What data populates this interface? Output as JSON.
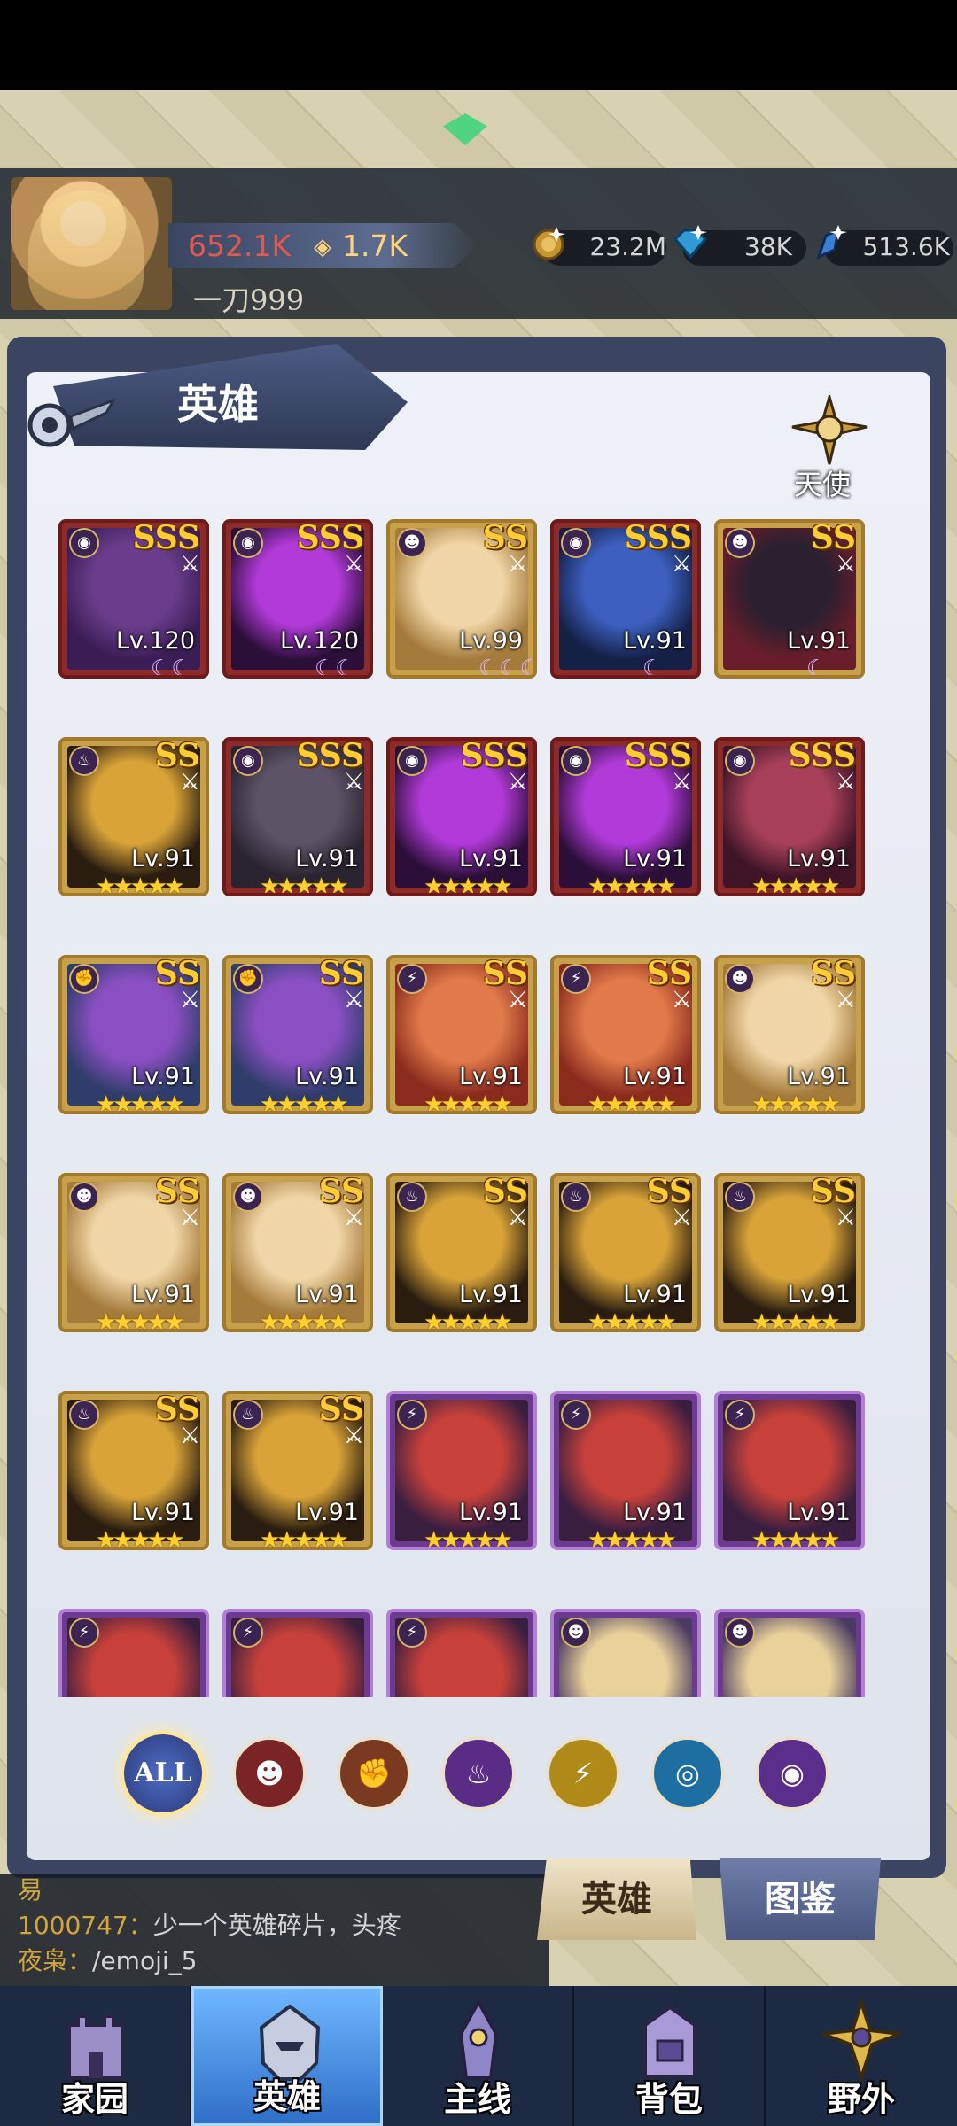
{
  "header": {
    "power": "652.1K",
    "secondary_stat": "1.7K",
    "player_name": "一刀999",
    "resources": [
      {
        "icon": "gold-coin-icon",
        "value": "23.2M"
      },
      {
        "icon": "diamond-icon",
        "value": "38K"
      },
      {
        "icon": "crystal-shard-icon",
        "value": "513.6K"
      }
    ]
  },
  "panel": {
    "title": "英雄",
    "angel_label": "天使"
  },
  "heroes": [
    {
      "rank": "SSS",
      "level": "Lv.120",
      "stars": "",
      "moons": "☾☾",
      "frame": "red",
      "element": "arcane",
      "art": "purple-crab"
    },
    {
      "rank": "SSS",
      "level": "Lv.120",
      "stars": "",
      "moons": "☾☾",
      "frame": "red",
      "element": "arcane",
      "art": "purple-demon"
    },
    {
      "rank": "SS",
      "level": "Lv.99",
      "stars": "",
      "moons": "☾☾☾☾",
      "frame": "gold",
      "element": "demon",
      "art": "blonde-warrior"
    },
    {
      "rank": "SSS",
      "level": "Lv.91",
      "stars": "",
      "moons": "☾",
      "frame": "red",
      "element": "arcane",
      "art": "blue-ghoul"
    },
    {
      "rank": "SS",
      "level": "Lv.91",
      "stars": "",
      "moons": "☾",
      "frame": "gold",
      "element": "demon",
      "art": "gothic-girl"
    },
    {
      "rank": "SS",
      "level": "Lv.91",
      "stars": "★★★★★",
      "moons": "",
      "frame": "gold",
      "element": "flame",
      "art": "hooded-figure"
    },
    {
      "rank": "SSS",
      "level": "Lv.91",
      "stars": "★★★★★",
      "moons": "",
      "frame": "red",
      "element": "arcane",
      "art": "octopus-brute"
    },
    {
      "rank": "SSS",
      "level": "Lv.91",
      "stars": "★★★★★",
      "moons": "",
      "frame": "red",
      "element": "arcane",
      "art": "purple-demon"
    },
    {
      "rank": "SSS",
      "level": "Lv.91",
      "stars": "★★★★★",
      "moons": "",
      "frame": "red",
      "element": "arcane",
      "art": "purple-demon"
    },
    {
      "rank": "SSS",
      "level": "Lv.91",
      "stars": "★★★★★",
      "moons": "",
      "frame": "red",
      "element": "arcane",
      "art": "tentacle-beast"
    },
    {
      "rank": "SS",
      "level": "Lv.91",
      "stars": "★★★★★",
      "moons": "",
      "frame": "gold",
      "element": "fist",
      "art": "witch-gunner"
    },
    {
      "rank": "SS",
      "level": "Lv.91",
      "stars": "★★★★★",
      "moons": "",
      "frame": "gold",
      "element": "fist",
      "art": "witch-gunner"
    },
    {
      "rank": "SS",
      "level": "Lv.91",
      "stars": "★★★★★",
      "moons": "",
      "frame": "gold",
      "element": "lightning",
      "art": "cat-king"
    },
    {
      "rank": "SS",
      "level": "Lv.91",
      "stars": "★★★★★",
      "moons": "",
      "frame": "gold",
      "element": "lightning",
      "art": "cat-king"
    },
    {
      "rank": "SS",
      "level": "Lv.91",
      "stars": "★★★★★",
      "moons": "",
      "frame": "gold",
      "element": "demon",
      "art": "blonde-warrior"
    },
    {
      "rank": "SS",
      "level": "Lv.91",
      "stars": "★★★★★",
      "moons": "",
      "frame": "gold",
      "element": "demon",
      "art": "blonde-warrior"
    },
    {
      "rank": "SS",
      "level": "Lv.91",
      "stars": "★★★★★",
      "moons": "",
      "frame": "gold",
      "element": "demon",
      "art": "blonde-warrior"
    },
    {
      "rank": "SS",
      "level": "Lv.91",
      "stars": "★★★★★",
      "moons": "",
      "frame": "gold",
      "element": "flame",
      "art": "hooded-figure"
    },
    {
      "rank": "SS",
      "level": "Lv.91",
      "stars": "★★★★★",
      "moons": "",
      "frame": "gold",
      "element": "flame",
      "art": "hooded-figure"
    },
    {
      "rank": "SS",
      "level": "Lv.91",
      "stars": "★★★★★",
      "moons": "",
      "frame": "gold",
      "element": "flame",
      "art": "hooded-figure"
    },
    {
      "rank": "SS",
      "level": "Lv.91",
      "stars": "★★★★★",
      "moons": "",
      "frame": "gold",
      "element": "flame",
      "art": "hooded-figure"
    },
    {
      "rank": "SS",
      "level": "Lv.91",
      "stars": "★★★★★",
      "moons": "",
      "frame": "gold",
      "element": "flame",
      "art": "hooded-figure"
    },
    {
      "rank": "",
      "level": "Lv.91",
      "stars": "★★★★★",
      "moons": "",
      "frame": "purple",
      "element": "lightning",
      "art": "bull-warrior"
    },
    {
      "rank": "",
      "level": "Lv.91",
      "stars": "★★★★★",
      "moons": "",
      "frame": "purple",
      "element": "lightning",
      "art": "bull-warrior"
    },
    {
      "rank": "",
      "level": "Lv.91",
      "stars": "★★★★★",
      "moons": "",
      "frame": "purple",
      "element": "lightning",
      "art": "bull-warrior"
    },
    {
      "rank": "",
      "level": "",
      "stars": "",
      "moons": "",
      "frame": "purple",
      "element": "lightning",
      "art": "bull-warrior"
    },
    {
      "rank": "",
      "level": "",
      "stars": "",
      "moons": "",
      "frame": "purple",
      "element": "lightning",
      "art": "bull-warrior"
    },
    {
      "rank": "",
      "level": "",
      "stars": "",
      "moons": "",
      "frame": "purple",
      "element": "lightning",
      "art": "bull-warrior"
    },
    {
      "rank": "",
      "level": "",
      "stars": "",
      "moons": "",
      "frame": "purple",
      "element": "demon",
      "art": "blond-soldier"
    },
    {
      "rank": "",
      "level": "",
      "stars": "",
      "moons": "",
      "frame": "purple",
      "element": "demon",
      "art": "blond-soldier"
    }
  ],
  "filters": {
    "all_label": "ALL",
    "items": [
      {
        "icon": "demon-face-icon",
        "color": "#7a2426"
      },
      {
        "icon": "fist-icon",
        "color": "#7a3a22"
      },
      {
        "icon": "flame-icon",
        "color": "#5b2c86"
      },
      {
        "icon": "lightning-icon",
        "color": "#b08a18"
      },
      {
        "icon": "swirl-icon",
        "color": "#1d6fa2"
      },
      {
        "icon": "arcane-eye-icon",
        "color": "#5a2e8a"
      }
    ]
  },
  "chat": {
    "line0": {
      "prefix": "易",
      "msg": ""
    },
    "line1": {
      "prefix": "1000747：",
      "msg": "少一个英雄碎片，头疼"
    },
    "line2": {
      "prefix": "夜枭：",
      "msg": "/emoji_5"
    }
  },
  "tabs": {
    "hero": "英雄",
    "atlas": "图鉴"
  },
  "nav": [
    {
      "label": "家园",
      "icon": "castle-icon"
    },
    {
      "label": "英雄",
      "icon": "helmet-icon"
    },
    {
      "label": "主线",
      "icon": "tower-icon"
    },
    {
      "label": "背包",
      "icon": "backpack-icon"
    },
    {
      "label": "野外",
      "icon": "compass-star-icon"
    }
  ],
  "colors": {
    "power": "#e3594f",
    "secondary": "#ffd27a",
    "nav_active": "#2f6fc8"
  }
}
